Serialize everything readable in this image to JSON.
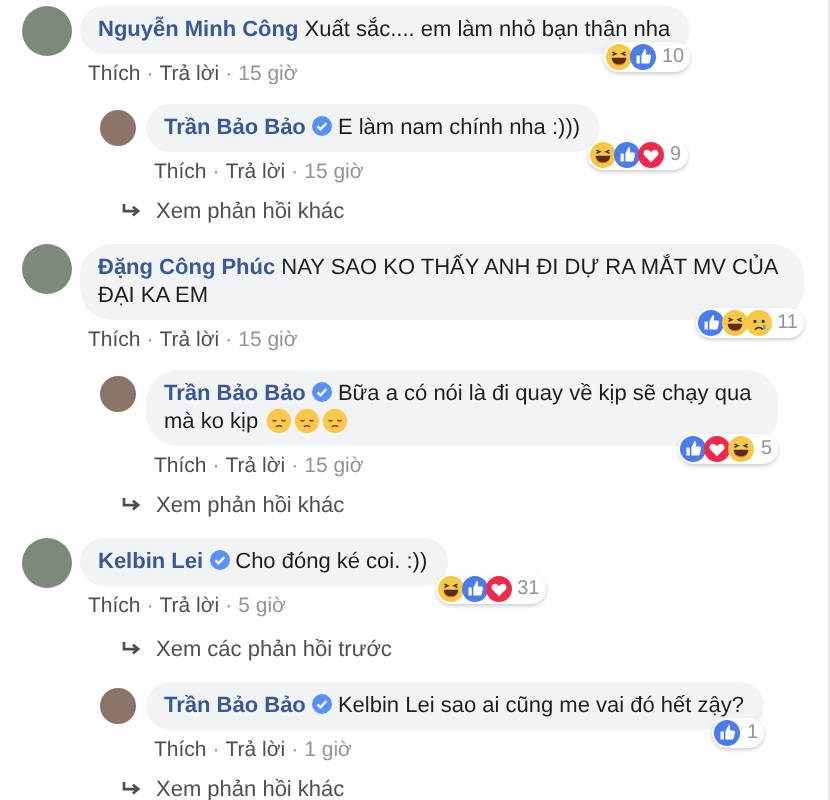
{
  "threads": [
    {
      "comment": {
        "author": "Nguyễn Minh Công",
        "verified": false,
        "text": "Xuất sắc.... em làm nhỏ bạn thân nha",
        "reactions": [
          {
            "kind": "haha"
          },
          {
            "kind": "like"
          }
        ],
        "count": "10",
        "actions": [
          "Thích",
          "·",
          "Trả lời",
          "·",
          "15 giờ"
        ]
      },
      "entries": [
        {
          "kind": "reply",
          "author": "Trần Bảo Bảo",
          "verified": true,
          "text": "E làm nam chính nha :)))",
          "reactions": [
            {
              "kind": "haha"
            },
            {
              "kind": "like"
            },
            {
              "kind": "love"
            }
          ],
          "count": "9",
          "actions": [
            "Thích",
            "·",
            "Trả lời",
            "·",
            "15 giờ"
          ]
        },
        {
          "kind": "link",
          "label": "Xem phản hồi khác"
        }
      ]
    },
    {
      "comment": {
        "author": "Đặng Công Phúc",
        "verified": false,
        "text": "NAY SAO KO THẤY ANH ĐI DỰ RA MẮT MV CỦA ĐẠI KA EM",
        "reactions": [
          {
            "kind": "like"
          },
          {
            "kind": "haha"
          },
          {
            "kind": "sad"
          }
        ],
        "count": "11",
        "actions": [
          "Thích",
          "·",
          "Trả lời",
          "·",
          "15 giờ"
        ]
      },
      "entries": [
        {
          "kind": "reply",
          "author": "Trần Bảo Bảo",
          "verified": true,
          "text": "Bữa a có nói là đi quay về kịp sẽ chạy qua mà ko kịp",
          "emojis": [
            {
              "kind": "sad"
            },
            {
              "kind": "sad"
            },
            {
              "kind": "sad"
            }
          ],
          "reactions": [
            {
              "kind": "like"
            },
            {
              "kind": "love"
            },
            {
              "kind": "haha"
            }
          ],
          "count": "5",
          "actions": [
            "Thích",
            "·",
            "Trả lời",
            "·",
            "15 giờ"
          ]
        },
        {
          "kind": "link",
          "label": "Xem phản hồi khác"
        }
      ]
    },
    {
      "comment": {
        "author": "Kelbin Lei",
        "verified": true,
        "text": "Cho đóng ké coi. :))",
        "reactions": [
          {
            "kind": "haha"
          },
          {
            "kind": "like"
          },
          {
            "kind": "love"
          }
        ],
        "count": "31",
        "actions": [
          "Thích",
          "·",
          "Trả lời",
          "·",
          "5 giờ"
        ]
      },
      "entries": [
        {
          "kind": "link",
          "label": "Xem các phản hồi trước"
        },
        {
          "kind": "reply",
          "author": "Trần Bảo Bảo",
          "verified": true,
          "text": "Kelbin Lei sao ai cũng me vai đó hết zậy?",
          "reactions": [
            {
              "kind": "like"
            }
          ],
          "count": "1",
          "actions": [
            "Thích",
            "·",
            "Trả lời",
            "·",
            "1 giờ"
          ]
        },
        {
          "kind": "link",
          "label": "Xem phản hồi khác"
        }
      ]
    }
  ]
}
